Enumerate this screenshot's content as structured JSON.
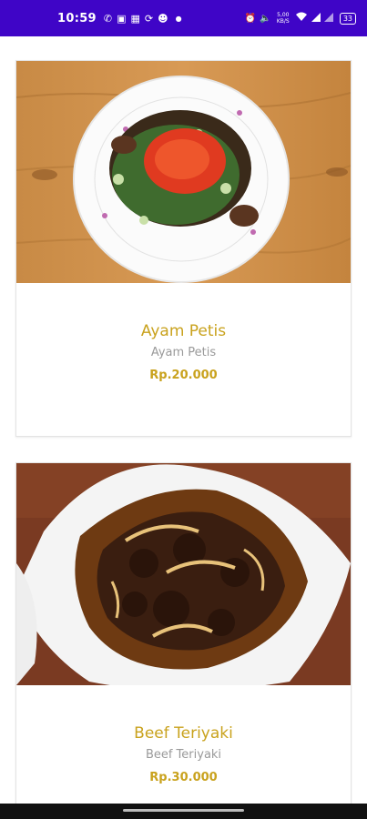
{
  "status_bar": {
    "time": "10:59",
    "speed": "5,00 KB/S",
    "battery": "33",
    "icons": [
      "whatsapp-icon",
      "bag-icon",
      "app-icon",
      "sync-icon",
      "face-icon",
      "dot",
      "alarm-icon",
      "mute-icon",
      "speed-text",
      "wifi-icon",
      "signal-icon",
      "signal-icon",
      "battery-icon"
    ]
  },
  "menu": {
    "items": [
      {
        "name": "Ayam Petis",
        "description": "Ayam Petis",
        "price": "Rp.20.000"
      },
      {
        "name": "Beef Teriyaki",
        "description": "Beef Teriyaki",
        "price": "Rp.30.000"
      }
    ]
  },
  "colors": {
    "status_bar": "#3f05c7",
    "accent": "#c9a21d",
    "subtitle": "#9a9a9a",
    "nav_bar": "#111111"
  }
}
